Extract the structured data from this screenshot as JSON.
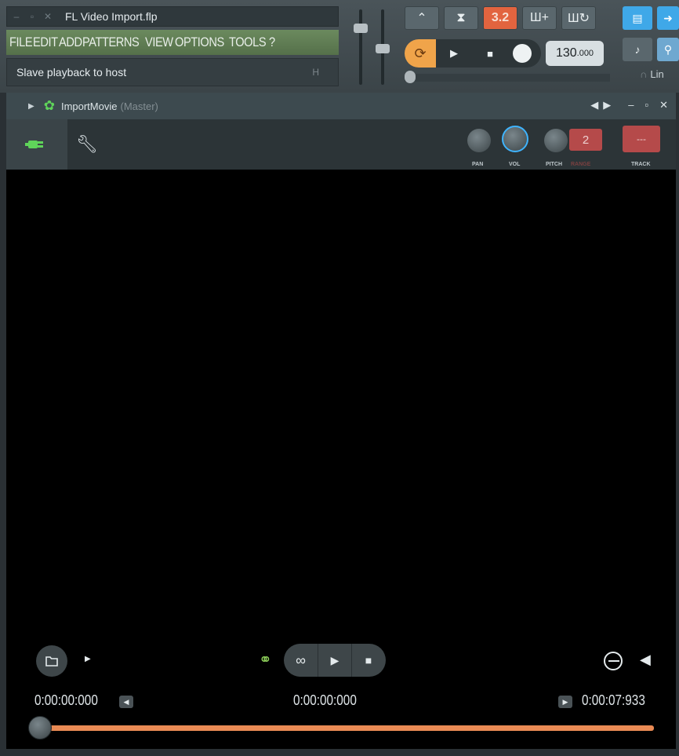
{
  "app": {
    "file_title": "FL Video Import.flp",
    "menu": [
      "FILE",
      "EDIT",
      "ADD",
      "PATTERNS",
      "VIEW",
      "OPTIONS",
      "TOOLS",
      "?"
    ],
    "hint": "Slave playback to host",
    "hint_shortcut": "H"
  },
  "transport": {
    "pattern_song_display": "3.2",
    "tempo_int": "130",
    "tempo_frac": ".000",
    "right_label": "Lin"
  },
  "plugin": {
    "name": "ImportMovie",
    "channel": "(Master)",
    "knobs": {
      "pan": "PAN",
      "vol": "VOL",
      "pitch": "PITCH",
      "range": "RANGE"
    },
    "range_value": "2",
    "track_value": "---",
    "track_label": "TRACK"
  },
  "player": {
    "time_start": "0:00:00:000",
    "time_current": "0:00:00:000",
    "time_end": "0:00:07:933",
    "position_fraction": 0.0
  },
  "colors": {
    "accent_green": "#5fd45a",
    "accent_orange": "#e98a54",
    "vol_ring": "#3fb4ff",
    "red_button": "#b54a4a"
  }
}
